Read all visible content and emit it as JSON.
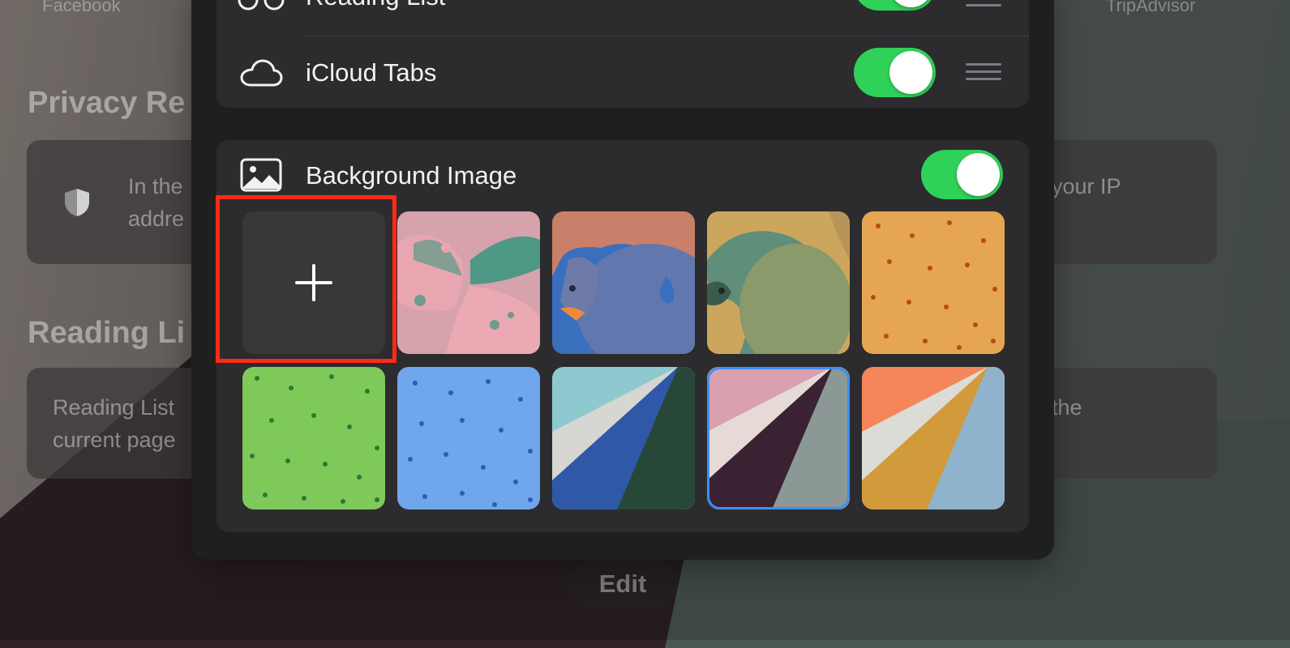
{
  "background_page": {
    "top_left_label": "Facebook",
    "top_right_label": "TripAdvisor",
    "privacy_heading": "Privacy Re",
    "privacy_text_left_1": "In the",
    "privacy_text_left_2": "addre",
    "privacy_text_right": "your IP",
    "reading_heading": "Reading Li",
    "reading_text_left_1": "Reading List",
    "reading_text_left_2": "current page",
    "reading_text_right": "the",
    "edit_button": "Edit"
  },
  "panel": {
    "sections": [
      {
        "label": "Reading List",
        "icon": "glasses-icon",
        "enabled": true
      },
      {
        "label": "iCloud Tabs",
        "icon": "cloud-icon",
        "enabled": true
      }
    ],
    "background_image": {
      "label": "Background Image",
      "icon": "photo-icon",
      "enabled": true,
      "add_tile_icon": "plus-icon",
      "tiles": [
        "butterfly",
        "bear",
        "parrot",
        "orange-dots",
        "green-dots",
        "blue-dots",
        "blue-green-diagonal",
        "pink-purple-diagonal",
        "orange-yellow-diagonal"
      ],
      "selected_tile": "pink-purple-diagonal"
    }
  },
  "colors": {
    "toggle_on": "#30d158",
    "selection": "#3d8ef7",
    "highlight": "#ff2a17"
  }
}
